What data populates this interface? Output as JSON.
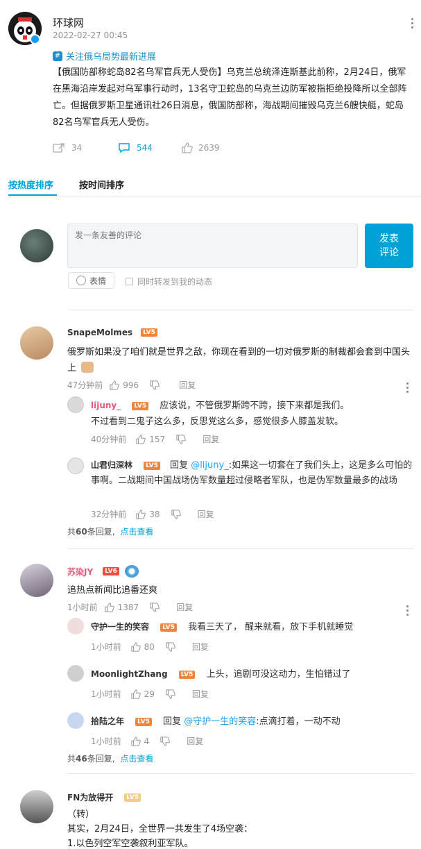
{
  "post": {
    "author": "环球网",
    "timestamp": "2022-02-27 00:45",
    "topic": "关注俄乌局势最新进展",
    "body": "【俄国防部称蛇岛82名乌军官兵无人受伤】乌克兰总统泽连斯基此前称，2月24日，俄军在黑海沿岸发起对乌军事行动时，13名守卫蛇岛的乌克兰边防军被指拒绝投降所以全部阵亡。但据俄罗斯卫星通讯社26日消息，俄国防部称，海战期间摧毁乌克兰6艘快艇，蛇岛82名乌军官兵无人受伤。",
    "repost_count": "34",
    "comment_count": "544",
    "like_count": "2639"
  },
  "tabs": {
    "hot": "按热度排序",
    "time": "按时间排序"
  },
  "composer": {
    "placeholder": "发一条友善的评论",
    "submit": "发表\n评论",
    "emoji": "表情",
    "repost_check": "同时转发到我的动态"
  },
  "comments": [
    {
      "user": "SnapeMolmes",
      "level": "LV5",
      "text": "俄罗斯如果没了咱们就是世界之敌，你现在看到的一切对俄罗斯的制裁都会套到中国头上",
      "time": "47分钟前",
      "likes": "996",
      "reply_label": "回复",
      "replies": [
        {
          "user": "lijuny_",
          "level": "LV5",
          "text1": "应该说，不管俄罗斯跨不跨，接下来都是我们。",
          "text2": "不过看到二鬼子这么多，反思党这么多，感觉很多人膝盖发软。",
          "time": "40分钟前",
          "likes": "157",
          "reply_label": "回复"
        },
        {
          "user": "山君归深林",
          "level": "LV5",
          "prefix": "回复",
          "mention": "@lijuny_",
          "text": ":如果这一切套在了我们头上，这是多么可怕的事啊。二战期间中国战场伪军数量超过侵略者军队，也是伪军数量最多的战场",
          "time": "32分钟前",
          "likes": "38",
          "reply_label": "回复"
        }
      ],
      "total_prefix": "共",
      "total_count": "60",
      "total_suffix": "条回复,",
      "view_more": "点击查看"
    },
    {
      "user": "苏染JY",
      "level": "LV6",
      "text": "追热点新闻比追番还爽",
      "time": "1小时前",
      "likes": "1387",
      "reply_label": "回复",
      "replies": [
        {
          "user": "守护一生的笑容",
          "level": "LV5",
          "text": "我看三天了， 醒来就看，放下手机就睡觉",
          "time": "1小时前",
          "likes": "80",
          "reply_label": "回复"
        },
        {
          "user": "MoonlightZhang",
          "level": "LV5",
          "text": "上头，追剧可没这动力，生怕错过了",
          "time": "1小时前",
          "likes": "29",
          "reply_label": "回复"
        },
        {
          "user": "拾陆之年",
          "level": "LV5",
          "prefix": "回复",
          "mention": "@守护一生的笑容",
          "text": ":点滴打着，一动不动",
          "time": "1小时前",
          "likes": "4",
          "reply_label": "回复"
        }
      ],
      "total_prefix": "共",
      "total_count": "46",
      "total_suffix": "条回复,",
      "view_more": "点击查看"
    },
    {
      "user": "FN为放得开",
      "level": "LV5",
      "line1": "（转）",
      "line2": "其实，2月24日，全世界一共发生了4场空袭：",
      "line3": "1.以色列空军空袭叙利亚军队。"
    }
  ],
  "colors": {
    "accent": "#00a1d6",
    "level": "#f0863d",
    "pink": "#e4577a"
  }
}
